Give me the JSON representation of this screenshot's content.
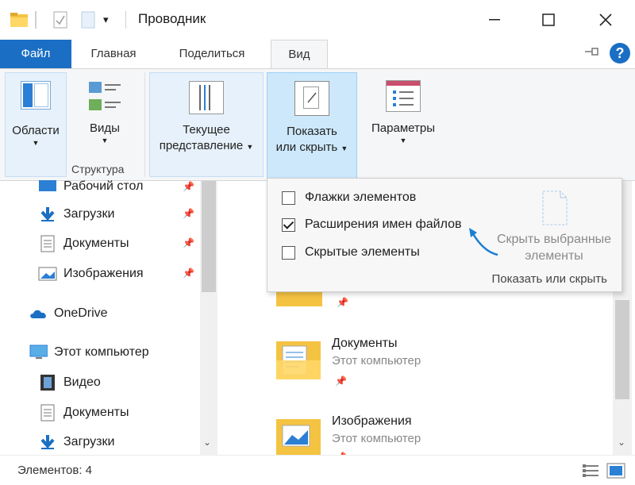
{
  "window": {
    "title": "Проводник"
  },
  "tabs": {
    "file": "Файл",
    "home": "Главная",
    "share": "Поделиться",
    "view": "Вид"
  },
  "ribbon": {
    "panes_label": "Области",
    "layout_label": "Виды",
    "group_structure": "Структура",
    "current_view_line1": "Текущее",
    "current_view_line2": "представление",
    "showhide_line1": "Показать",
    "showhide_line2": "или скрыть",
    "options_label": "Параметры"
  },
  "nav": {
    "items": [
      {
        "label": "Рабочий стол",
        "icon": "desktop-icon"
      },
      {
        "label": "Загрузки",
        "icon": "download-arrow-icon"
      },
      {
        "label": "Документы",
        "icon": "document-icon"
      },
      {
        "label": "Изображения",
        "icon": "image-icon"
      },
      {
        "label": "OneDrive",
        "icon": "cloud-icon"
      },
      {
        "label": "Этот компьютер",
        "icon": "computer-icon"
      },
      {
        "label": "Видео",
        "icon": "film-icon"
      },
      {
        "label": "Документы",
        "icon": "document-icon"
      },
      {
        "label": "Загрузки",
        "icon": "download-arrow-icon"
      }
    ]
  },
  "main": {
    "items": [
      {
        "name": "Документы",
        "location": "Этот компьютер"
      },
      {
        "name": "Изображения",
        "location": "Этот компьютер"
      }
    ]
  },
  "popup": {
    "checkbox_item_checkboxes": "Флажки элементов",
    "checkbox_file_extensions": "Расширения имен файлов",
    "checkbox_hidden_items": "Скрытые элементы",
    "item_checkboxes_checked": false,
    "file_extensions_checked": true,
    "hidden_items_checked": false,
    "hide_selected_line1": "Скрыть выбранные",
    "hide_selected_line2": "элементы",
    "group_label": "Показать или скрыть"
  },
  "status": {
    "items_count": "Элементов: 4"
  },
  "colors": {
    "accent": "#1a6fc4",
    "highlight": "#cde8fb",
    "arrow": "#1a7fd4"
  }
}
